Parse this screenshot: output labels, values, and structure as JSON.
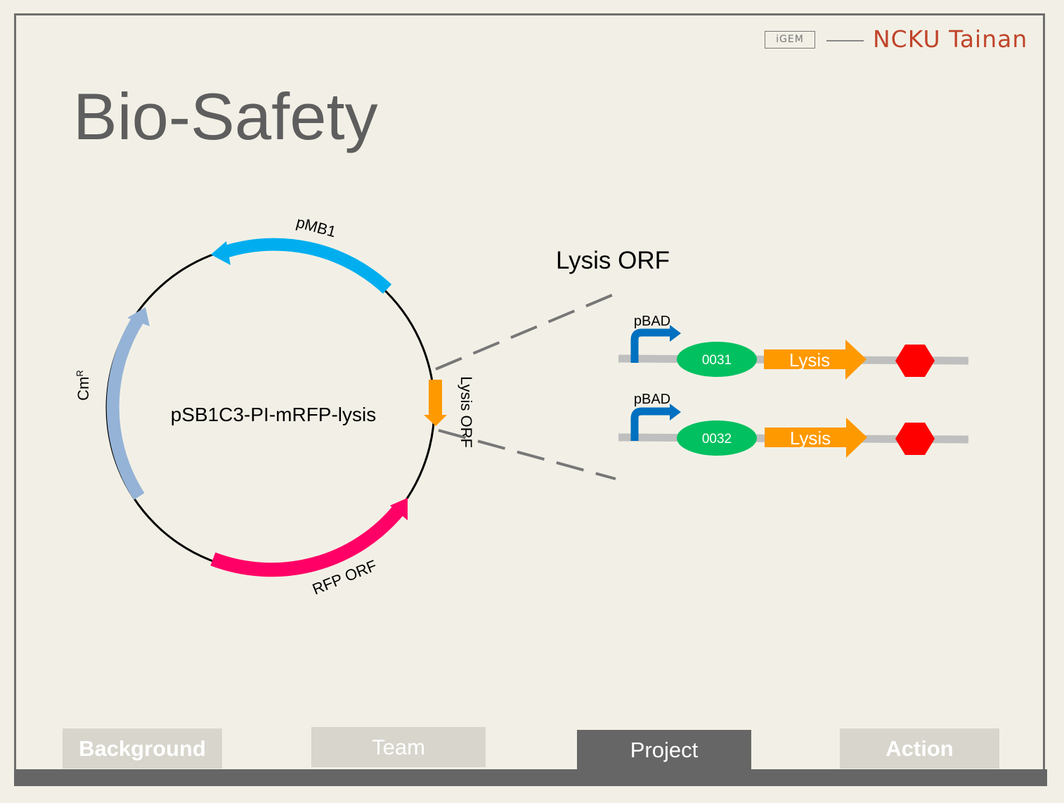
{
  "header": {
    "logo_text": "iGEM",
    "team_name": "NCKU Tainan"
  },
  "page": {
    "title": "Bio-Safety"
  },
  "plasmid": {
    "name": "pSB1C3-PI-mRFP-lysis",
    "features": {
      "origin": "pMB1",
      "resistance_main": "Cm",
      "resistance_sup": "R",
      "rfp": "RFP ORF",
      "lysis": "Lysis ORF"
    },
    "colors": {
      "origin": "#00aeef",
      "resistance": "#95b3d7",
      "rfp": "#ff0066",
      "lysis": "#ff9900"
    }
  },
  "zoom": {
    "title": "Lysis ORF",
    "constructs": [
      {
        "promoter": "pBAD",
        "rbs": "0031",
        "gene": "Lysis"
      },
      {
        "promoter": "pBAD",
        "rbs": "0032",
        "gene": "Lysis"
      }
    ],
    "colors": {
      "promoter": "#0070c0",
      "rbs": "#00c060",
      "gene": "#ff9900",
      "terminator": "#ff0000"
    }
  },
  "nav": {
    "background": "Background",
    "team": "Team",
    "project": "Project",
    "action": "Action",
    "active": "Project"
  }
}
